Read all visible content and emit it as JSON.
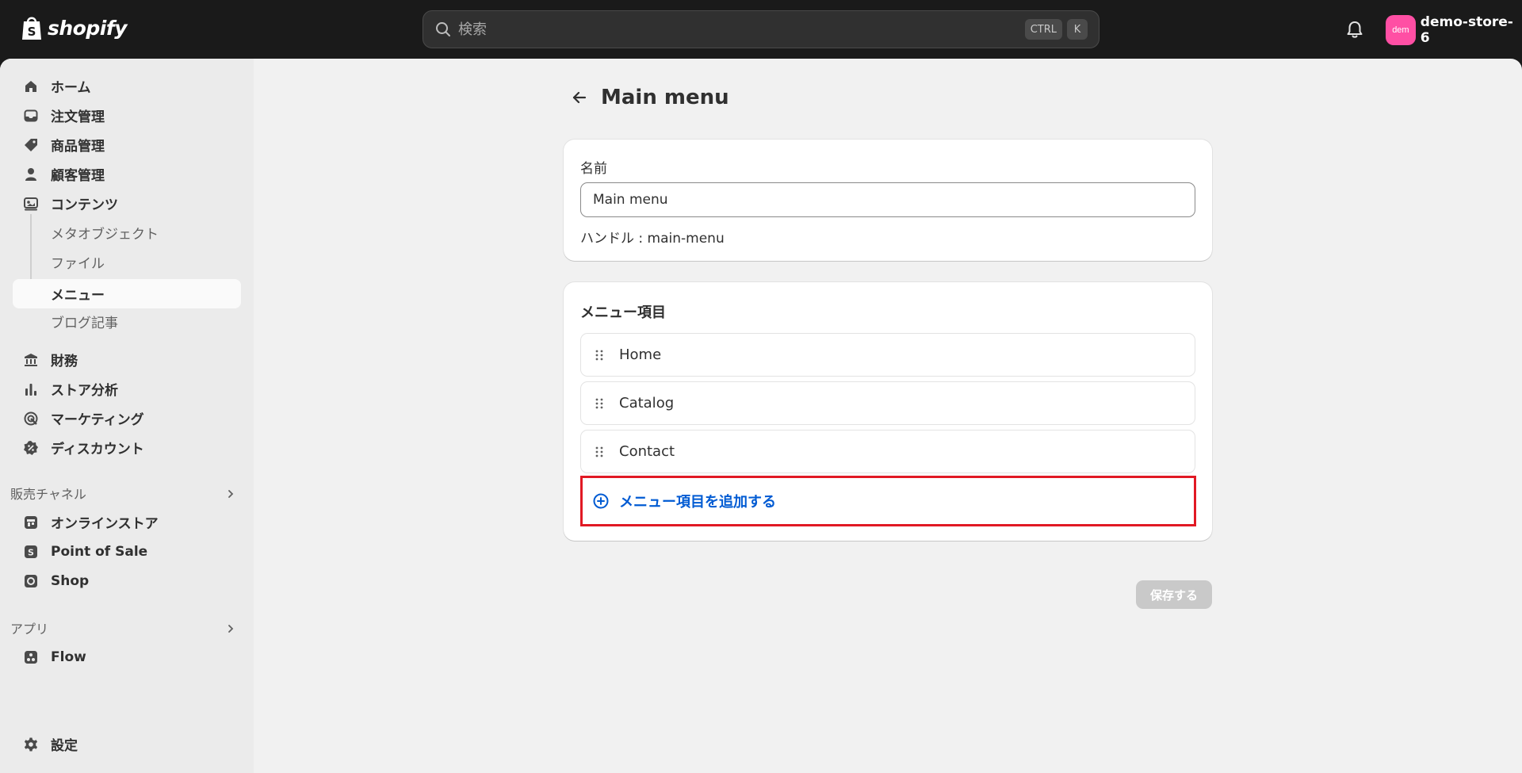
{
  "topbar": {
    "brand": "shopify",
    "search_placeholder": "検索",
    "shortcut_keys": [
      "CTRL",
      "K"
    ],
    "avatar_initials": "dem",
    "store_name": "demo-store-6"
  },
  "sidebar": {
    "items": [
      {
        "label": "ホーム",
        "icon": "home-icon"
      },
      {
        "label": "注文管理",
        "icon": "inbox-icon"
      },
      {
        "label": "商品管理",
        "icon": "tag-icon"
      },
      {
        "label": "顧客管理",
        "icon": "person-icon"
      },
      {
        "label": "コンテンツ",
        "icon": "content-icon"
      }
    ],
    "content_subitems": [
      "メタオブジェクト",
      "ファイル",
      "メニュー",
      "ブログ記事"
    ],
    "active_subitem": "メニュー",
    "items2": [
      {
        "label": "財務",
        "icon": "bank-icon"
      },
      {
        "label": "ストア分析",
        "icon": "chart-icon"
      },
      {
        "label": "マーケティング",
        "icon": "target-icon"
      },
      {
        "label": "ディスカウント",
        "icon": "discount-icon"
      }
    ],
    "sales_channels_label": "販売チャネル",
    "sales_channels": [
      {
        "label": "オンラインストア",
        "icon": "store-icon"
      },
      {
        "label": "Point of Sale",
        "icon": "pos-icon"
      },
      {
        "label": "Shop",
        "icon": "shop-icon"
      }
    ],
    "apps_label": "アプリ",
    "apps": [
      {
        "label": "Flow",
        "icon": "flow-icon"
      }
    ],
    "settings_label": "設定"
  },
  "page": {
    "title": "Main menu",
    "name_label": "名前",
    "name_value": "Main menu",
    "handle_text": "ハンドル : main-menu",
    "menu_items_title": "メニュー項目",
    "menu_items": [
      "Home",
      "Catalog",
      "Contact"
    ],
    "add_item_label": "メニュー項目を追加する",
    "save_label": "保存する"
  },
  "colors": {
    "topbar": "#1a1a1a",
    "avatar": "#ff4fa4",
    "link": "#005bd3",
    "highlight": "#e11924",
    "save_disabled": "#c9c9c9"
  }
}
